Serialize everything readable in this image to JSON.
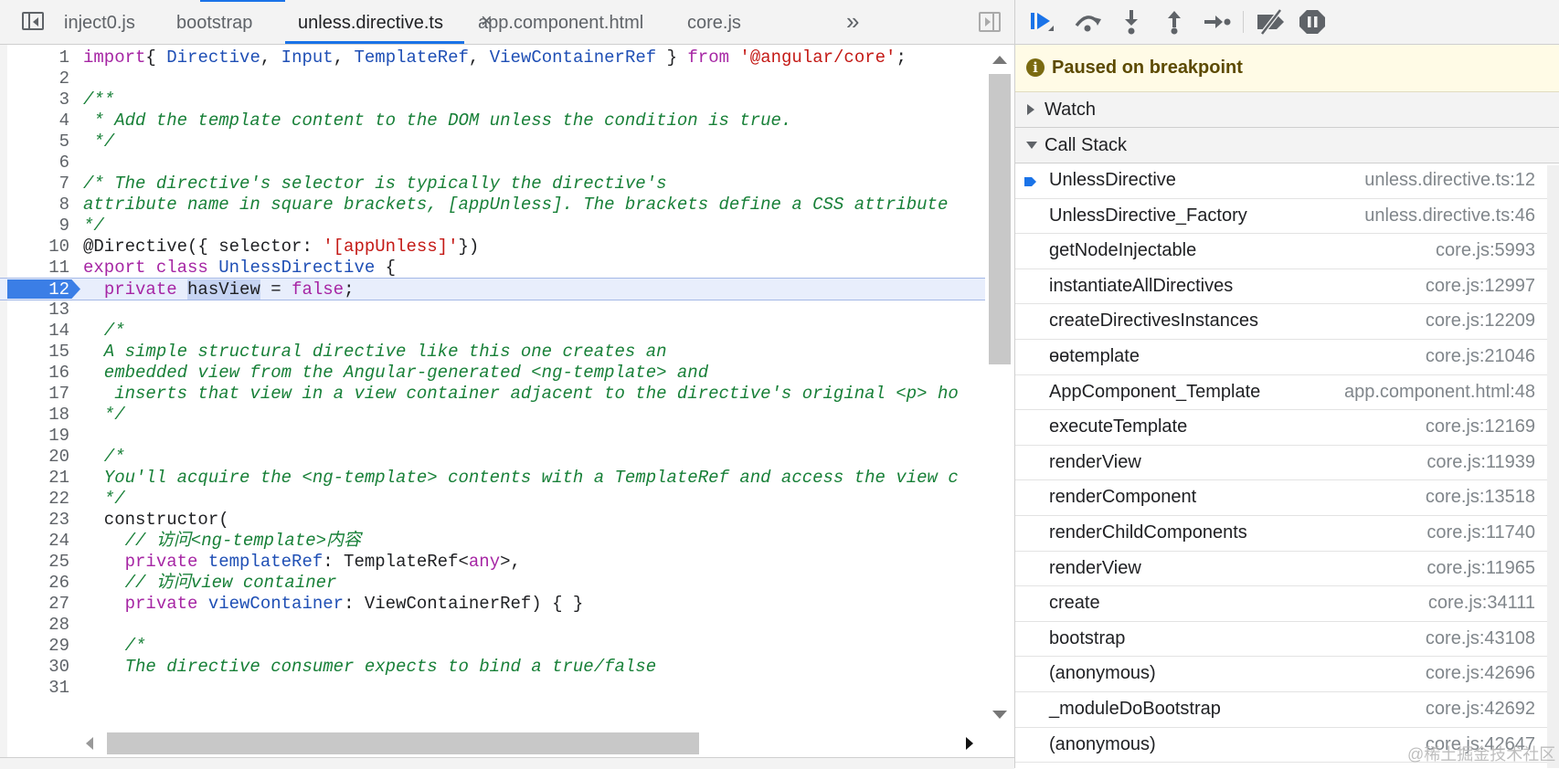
{
  "tabs": [
    {
      "label": "inject0.js",
      "active": false
    },
    {
      "label": "bootstrap",
      "active": false
    },
    {
      "label": "unless.directive.ts",
      "active": true
    },
    {
      "label": "app.component.html",
      "active": false
    },
    {
      "label": "core.js",
      "active": false
    }
  ],
  "tab_close_symbol": "×",
  "more_tabs_symbol": "»",
  "breakpoint_line": 12,
  "code_lines": [
    {
      "n": "1",
      "parts": [
        [
          "k",
          "import"
        ],
        [
          "",
          "{ "
        ],
        [
          "n",
          "Directive"
        ],
        [
          "",
          ", "
        ],
        [
          "n",
          "Input"
        ],
        [
          "",
          ", "
        ],
        [
          "n",
          "TemplateRef"
        ],
        [
          "",
          ", "
        ],
        [
          "n",
          "ViewContainerRef"
        ],
        [
          "",
          " } "
        ],
        [
          "k",
          "from"
        ],
        [
          "",
          " "
        ],
        [
          "s",
          "'@angular/core'"
        ],
        [
          "",
          ";"
        ]
      ]
    },
    {
      "n": "2",
      "parts": []
    },
    {
      "n": "3",
      "parts": [
        [
          "c",
          "/**"
        ]
      ]
    },
    {
      "n": "4",
      "parts": [
        [
          "c",
          " * Add the template content to the DOM unless the condition is true."
        ]
      ]
    },
    {
      "n": "5",
      "parts": [
        [
          "c",
          " */"
        ]
      ]
    },
    {
      "n": "6",
      "parts": []
    },
    {
      "n": "7",
      "parts": [
        [
          "c",
          "/* The directive's selector is typically the directive's"
        ]
      ]
    },
    {
      "n": "8",
      "parts": [
        [
          "c",
          "attribute name in square brackets, [appUnless]. The brackets define a CSS attribute"
        ]
      ]
    },
    {
      "n": "9",
      "parts": [
        [
          "c",
          "*/"
        ]
      ]
    },
    {
      "n": "10",
      "parts": [
        [
          "",
          "@Directive({ selector: "
        ],
        [
          "s",
          "'[appUnless]'"
        ],
        [
          "",
          "})"
        ]
      ]
    },
    {
      "n": "11",
      "parts": [
        [
          "k",
          "export class "
        ],
        [
          "n",
          "UnlessDirective"
        ],
        [
          "",
          " {"
        ]
      ]
    },
    {
      "n": "12",
      "parts": [
        [
          "",
          "  "
        ],
        [
          "k",
          "private "
        ],
        [
          "sel",
          "hasView"
        ],
        [
          "",
          " = "
        ],
        [
          "k",
          "false"
        ],
        [
          "",
          ";"
        ]
      ]
    },
    {
      "n": "13",
      "parts": []
    },
    {
      "n": "14",
      "parts": [
        [
          "c",
          "  /*"
        ]
      ]
    },
    {
      "n": "15",
      "parts": [
        [
          "c",
          "  A simple structural directive like this one creates an"
        ]
      ]
    },
    {
      "n": "16",
      "parts": [
        [
          "c",
          "  embedded view from the Angular-generated <ng-template> and"
        ]
      ]
    },
    {
      "n": "17",
      "parts": [
        [
          "c",
          "   inserts that view in a view container adjacent to the directive's original <p> ho"
        ]
      ]
    },
    {
      "n": "18",
      "parts": [
        [
          "c",
          "  */"
        ]
      ]
    },
    {
      "n": "19",
      "parts": []
    },
    {
      "n": "20",
      "parts": [
        [
          "c",
          "  /*"
        ]
      ]
    },
    {
      "n": "21",
      "parts": [
        [
          "c",
          "  You'll acquire the <ng-template> contents with a TemplateRef and access the view c"
        ]
      ]
    },
    {
      "n": "22",
      "parts": [
        [
          "c",
          "  */"
        ]
      ]
    },
    {
      "n": "23",
      "parts": [
        [
          "",
          "  constructor("
        ]
      ]
    },
    {
      "n": "24",
      "parts": [
        [
          "c",
          "    // 访问<ng-template>内容"
        ]
      ]
    },
    {
      "n": "25",
      "parts": [
        [
          "",
          "    "
        ],
        [
          "k",
          "private "
        ],
        [
          "n",
          "templateRef"
        ],
        [
          "",
          ": TemplateRef<"
        ],
        [
          "k",
          "any"
        ],
        [
          "",
          ">,"
        ]
      ]
    },
    {
      "n": "26",
      "parts": [
        [
          "c",
          "    // 访问view container"
        ]
      ]
    },
    {
      "n": "27",
      "parts": [
        [
          "",
          "    "
        ],
        [
          "k",
          "private "
        ],
        [
          "n",
          "viewContainer"
        ],
        [
          "",
          ": ViewContainerRef) { }"
        ]
      ]
    },
    {
      "n": "28",
      "parts": []
    },
    {
      "n": "29",
      "parts": [
        [
          "c",
          "    /*"
        ]
      ]
    },
    {
      "n": "30",
      "parts": [
        [
          "c",
          "    The directive consumer expects to bind a true/false"
        ]
      ]
    },
    {
      "n": "31",
      "parts": []
    }
  ],
  "paused_message": "Paused on breakpoint",
  "sections": {
    "watch": "Watch",
    "call_stack": "Call Stack"
  },
  "call_stack": [
    {
      "fn": "UnlessDirective",
      "loc": "unless.directive.ts:12",
      "current": true
    },
    {
      "fn": "UnlessDirective_Factory",
      "loc": "unless.directive.ts:46"
    },
    {
      "fn": "getNodeInjectable",
      "loc": "core.js:5993"
    },
    {
      "fn": "instantiateAllDirectives",
      "loc": "core.js:12997"
    },
    {
      "fn": "createDirectivesInstances",
      "loc": "core.js:12209"
    },
    {
      "fn": "ɵɵtemplate",
      "loc": "core.js:21046"
    },
    {
      "fn": "AppComponent_Template",
      "loc": "app.component.html:48"
    },
    {
      "fn": "executeTemplate",
      "loc": "core.js:12169"
    },
    {
      "fn": "renderView",
      "loc": "core.js:11939"
    },
    {
      "fn": "renderComponent",
      "loc": "core.js:13518"
    },
    {
      "fn": "renderChildComponents",
      "loc": "core.js:11740"
    },
    {
      "fn": "renderView",
      "loc": "core.js:11965"
    },
    {
      "fn": "create",
      "loc": "core.js:34111"
    },
    {
      "fn": "bootstrap",
      "loc": "core.js:43108"
    },
    {
      "fn": "(anonymous)",
      "loc": "core.js:42696"
    },
    {
      "fn": "_moduleDoBootstrap",
      "loc": "core.js:42692"
    },
    {
      "fn": "(anonymous)",
      "loc": "core.js:42647"
    }
  ],
  "watermark": "@稀土掘金技术社区",
  "colors": {
    "accent": "#1a73e8",
    "breakpoint": "#3b7ee6",
    "paused_bg": "#fffbe6"
  }
}
